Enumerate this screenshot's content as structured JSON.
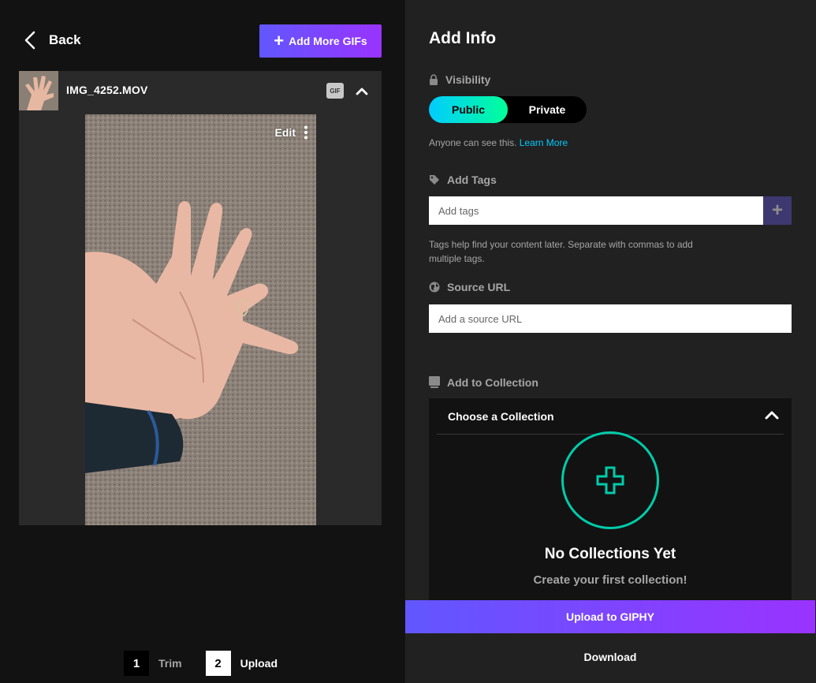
{
  "left": {
    "back_label": "Back",
    "add_more_label": "Add More GIFs",
    "file": {
      "name": "IMG_4252.MOV",
      "badge": "GIF",
      "edit_label": "Edit"
    },
    "steps": [
      {
        "number": "1",
        "label": "Trim",
        "active": false
      },
      {
        "number": "2",
        "label": "Upload",
        "active": true
      }
    ]
  },
  "right": {
    "title": "Add Info",
    "visibility": {
      "label": "Visibility",
      "options": [
        "Public",
        "Private"
      ],
      "selected": "Public",
      "helper": "Anyone can see this.",
      "learn_more": "Learn More"
    },
    "tags": {
      "label": "Add Tags",
      "placeholder": "Add tags",
      "helper_line1": "Tags help find your content later. Separate with commas to add",
      "helper_line2": "multiple tags."
    },
    "source": {
      "label": "Source URL",
      "placeholder": "Add a source URL"
    },
    "collection": {
      "label": "Add to Collection",
      "dropdown": "Choose a Collection",
      "empty_title": "No Collections Yet",
      "empty_subtitle": "Create your first collection!"
    },
    "upload_label": "Upload to GIPHY",
    "download_label": "Download"
  },
  "colors": {
    "accent_start": "#6157ff",
    "accent_end": "#9933ff",
    "toggle_start": "#00ccff",
    "toggle_end": "#00ff99",
    "link": "#00ccff",
    "circle": "#00ccaa"
  }
}
